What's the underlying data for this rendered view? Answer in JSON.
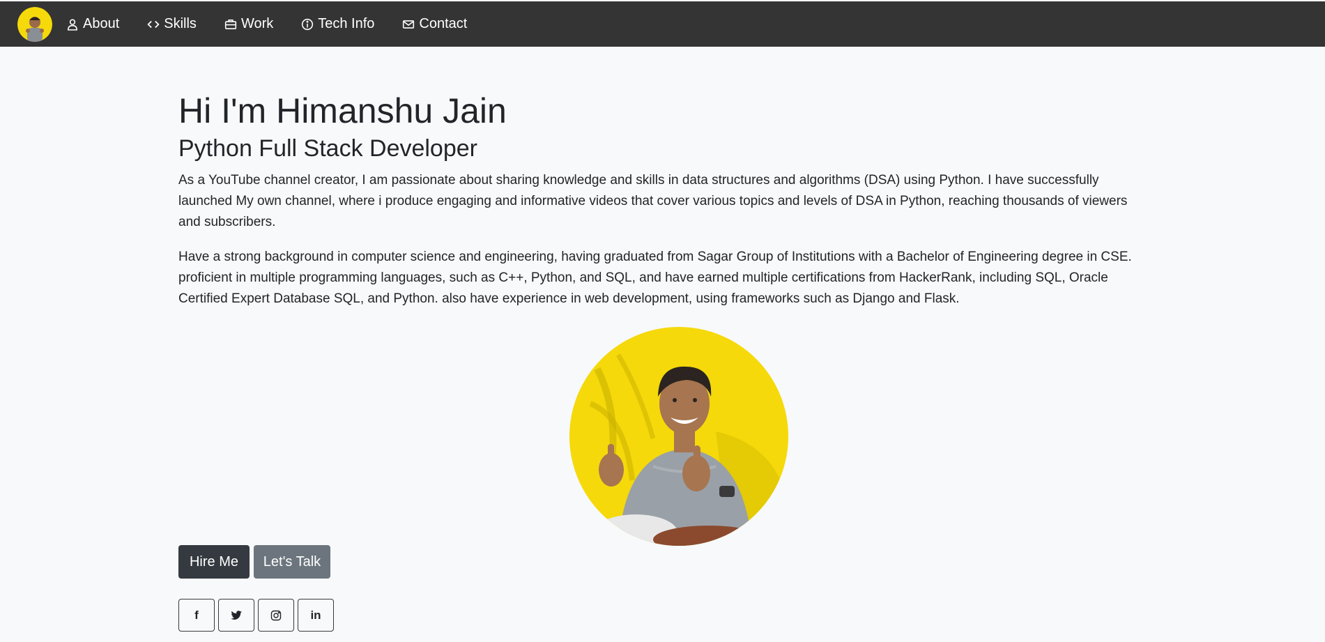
{
  "nav": {
    "logo_alt": "Himanshu Jain avatar",
    "items": [
      {
        "label": "About",
        "icon": "person-icon"
      },
      {
        "label": "Skills",
        "icon": "code-icon"
      },
      {
        "label": "Work",
        "icon": "briefcase-icon"
      },
      {
        "label": "Tech Info",
        "icon": "info-circle-icon"
      },
      {
        "label": "Contact",
        "icon": "envelope-icon"
      }
    ]
  },
  "hero": {
    "title": "Hi I'm Himanshu Jain",
    "subtitle": "Python Full Stack Developer",
    "paragraphs": [
      "As a YouTube channel creator, I am passionate about sharing knowledge and skills in data structures and algorithms (DSA) using Python. I have successfully launched My own channel, where i produce engaging and informative videos that cover various topics and levels of DSA in Python, reaching thousands of viewers and subscribers.",
      "Have a strong background in computer science and engineering, having graduated from Sagar Group of Institutions with a Bachelor of Engineering degree in CSE. proficient in multiple programming languages, such as C++, Python, and SQL, and have earned multiple certifications from HackerRank, including SQL, Oracle Certified Expert Database SQL, and Python. also have experience in web development, using frameworks such as Django and Flask."
    ]
  },
  "actions": {
    "hire_label": "Hire Me",
    "talk_label": "Let's Talk"
  },
  "social": [
    {
      "name": "facebook-icon",
      "glyph": "f"
    },
    {
      "name": "twitter-icon",
      "glyph": ""
    },
    {
      "name": "instagram-icon",
      "glyph": ""
    },
    {
      "name": "linkedin-icon",
      "glyph": "in"
    }
  ],
  "colors": {
    "navbar": "#343434",
    "background": "#f8f9fa",
    "portrait_bg": "#f5d90a",
    "btn_dark": "#343a40",
    "btn_gray": "#6c757d"
  }
}
